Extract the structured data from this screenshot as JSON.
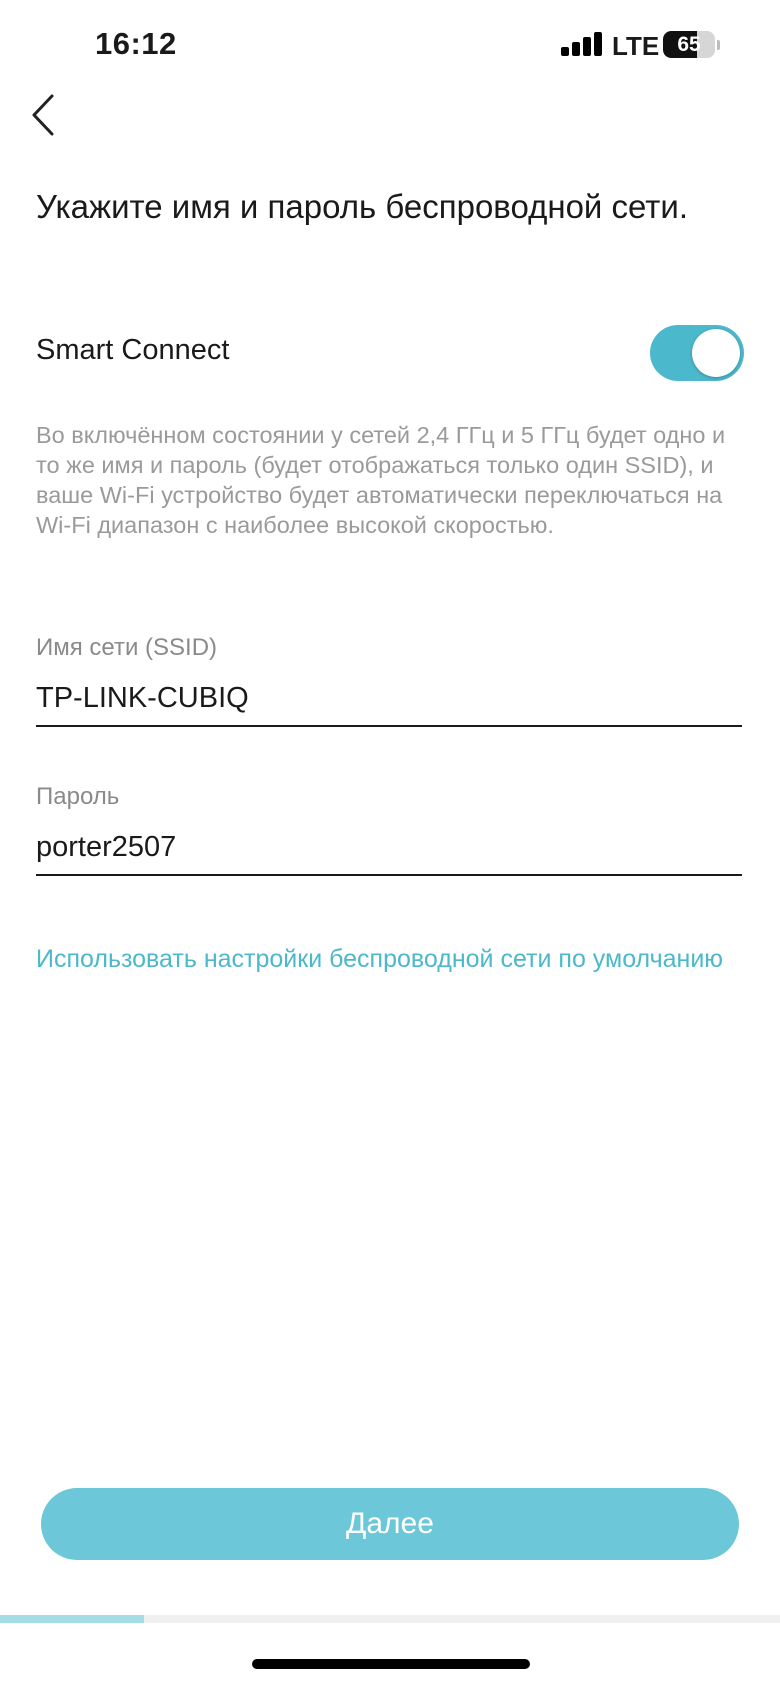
{
  "status_bar": {
    "time": "16:12",
    "network": "LTE",
    "battery": "65",
    "battery_level": 0.65,
    "signal_bars": 4
  },
  "header": {
    "back_icon": "chevron-left-icon",
    "title": "Укажите имя и пароль беспроводной сети."
  },
  "smart_connect": {
    "label": "Smart Connect",
    "enabled": true,
    "toggle_color": "#4cb8cc",
    "description": "Во включённом состоянии у сетей 2,4 ГГц и 5 ГГц будет одно и то же имя и пароль (будет отображаться только один SSID), и ваше Wi-Fi устройство будет автоматически переключаться на Wi-Fi диапазон с наиболее высокой скоростью."
  },
  "ssid": {
    "label": "Имя сети (SSID)",
    "value": "TP-LINK-CUBIQ"
  },
  "password": {
    "label": "Пароль",
    "value": "porter2507"
  },
  "default_settings_link": "Использовать настройки беспроводной сети по умолчанию",
  "next_button": {
    "label": "Далее",
    "color": "#6cc8d8"
  },
  "progress": {
    "fraction": 0.185,
    "color": "#a5dde7"
  }
}
